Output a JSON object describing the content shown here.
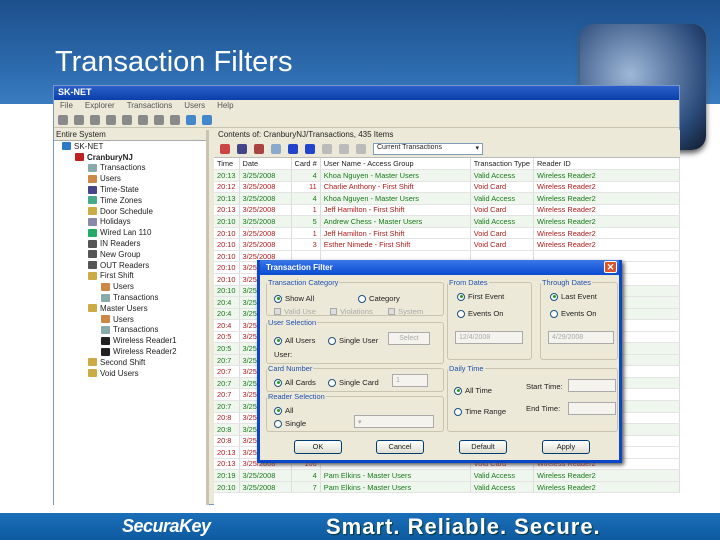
{
  "slide": {
    "title": "Transaction Filters",
    "logo": "SecuraKey",
    "tagline": "Smart. Reliable. Secure."
  },
  "app": {
    "title": "SK-NET",
    "menu": [
      "File",
      "Explorer",
      "Transactions",
      "Users",
      "Help"
    ]
  },
  "tree": {
    "header": "Entire System",
    "items": [
      {
        "label": "SK-NET",
        "lvl": 0,
        "c": "#2a7ac8"
      },
      {
        "label": "CranburyNJ",
        "lvl": 1,
        "c": "#c02020",
        "bold": true
      },
      {
        "label": "Transactions",
        "lvl": 2,
        "c": "#8aa"
      },
      {
        "label": "Users",
        "lvl": 2,
        "c": "#c84"
      },
      {
        "label": "Time-State",
        "lvl": 2,
        "c": "#448"
      },
      {
        "label": "Time Zones",
        "lvl": 2,
        "c": "#4a8"
      },
      {
        "label": "Door Schedule",
        "lvl": 2,
        "c": "#ca4"
      },
      {
        "label": "Holidays",
        "lvl": 2,
        "c": "#88a"
      },
      {
        "label": "Wired Lan 110",
        "lvl": 2,
        "c": "#2a6"
      },
      {
        "label": "IN Readers",
        "lvl": 2,
        "c": "#555"
      },
      {
        "label": "New Group",
        "lvl": 2,
        "c": "#555"
      },
      {
        "label": "OUT Readers",
        "lvl": 2,
        "c": "#555"
      },
      {
        "label": "First Shift",
        "lvl": 2,
        "c": "#ca4"
      },
      {
        "label": "Users",
        "lvl": 3,
        "c": "#c84"
      },
      {
        "label": "Transactions",
        "lvl": 3,
        "c": "#8aa"
      },
      {
        "label": "Master Users",
        "lvl": 2,
        "c": "#ca4"
      },
      {
        "label": "Users",
        "lvl": 3,
        "c": "#c84"
      },
      {
        "label": "Transactions",
        "lvl": 3,
        "c": "#8aa"
      },
      {
        "label": "Wireless Reader1",
        "lvl": 3,
        "c": "#222"
      },
      {
        "label": "Wireless Reader2",
        "lvl": 3,
        "c": "#222"
      },
      {
        "label": "Second Shift",
        "lvl": 2,
        "c": "#ca4"
      },
      {
        "label": "Void Users",
        "lvl": 2,
        "c": "#ca4"
      }
    ]
  },
  "grid": {
    "path": "Contents of: CranburyNJ/Transactions, 435 Items",
    "view": "Current Transactions",
    "columns": [
      "Time",
      "Date",
      "Card #",
      "User Name - Access Group",
      "Transaction Type",
      "Reader ID"
    ],
    "rows": [
      [
        "20:13",
        "3/25/2008",
        "4",
        "Khoa Nguyen - Master Users",
        "Valid Access",
        "Wireless Reader2",
        "g"
      ],
      [
        "20:12",
        "3/25/2008",
        "11",
        "Charlie Anthony - First Shift",
        "Void Card",
        "Wireless Reader2",
        "r"
      ],
      [
        "20:13",
        "3/25/2008",
        "4",
        "Khoa Nguyen - Master Users",
        "Valid Access",
        "Wireless Reader2",
        "g"
      ],
      [
        "20:13",
        "3/25/2008",
        "1",
        "Jeff Hamilton - First Shift",
        "Void Card",
        "Wireless Reader2",
        "r"
      ],
      [
        "20:10",
        "3/25/2008",
        "5",
        "Andrew Chess - Master Users",
        "Valid Access",
        "Wireless Reader2",
        "g"
      ],
      [
        "20:10",
        "3/25/2008",
        "1",
        "Jeff Hamilton - First Shift",
        "Void Card",
        "Wireless Reader2",
        "r"
      ],
      [
        "20:10",
        "3/25/2008",
        "3",
        "Esther Nimede - First Shift",
        "Void Card",
        "Wireless Reader2",
        "r"
      ],
      [
        "20:10",
        "3/25/2008",
        "",
        "",
        "",
        "",
        "r"
      ],
      [
        "20:10",
        "3/25/2008",
        "",
        "",
        "",
        "",
        "r"
      ],
      [
        "20:10",
        "3/25/2008",
        "",
        "",
        "",
        "",
        "r"
      ],
      [
        "20:10",
        "3/25/2008",
        "",
        "",
        "",
        "",
        "g"
      ],
      [
        "20:4",
        "3/25/2008",
        "",
        "",
        "",
        "",
        "g"
      ],
      [
        "20:4",
        "3/25/2008",
        "",
        "",
        "",
        "",
        "g"
      ],
      [
        "20:4",
        "3/25/2008",
        "",
        "",
        "",
        "",
        "r"
      ],
      [
        "20:5",
        "3/25/2008",
        "",
        "",
        "",
        "",
        "r"
      ],
      [
        "20:5",
        "3/25/2008",
        "",
        "",
        "",
        "",
        "g"
      ],
      [
        "20:7",
        "3/25/2008",
        "",
        "",
        "",
        "",
        "g"
      ],
      [
        "20:7",
        "3/25/2008",
        "",
        "",
        "",
        "",
        "r"
      ],
      [
        "20:7",
        "3/25/2008",
        "",
        "",
        "",
        "",
        "g"
      ],
      [
        "20:7",
        "3/25/2008",
        "",
        "",
        "",
        "",
        "r"
      ],
      [
        "20:7",
        "3/25/2008",
        "",
        "",
        "",
        "",
        "g"
      ],
      [
        "20:8",
        "3/25/2008",
        "",
        "",
        "",
        "",
        "r"
      ],
      [
        "20:8",
        "3/25/2008",
        "",
        "",
        "",
        "",
        "g"
      ],
      [
        "20:8",
        "3/25/2008",
        "",
        "",
        "",
        "",
        "r"
      ],
      [
        "20:13",
        "3/25/2008",
        "",
        "",
        "",
        "",
        "r"
      ],
      [
        "20:13",
        "3/25/2008",
        "106",
        "",
        "Void Card",
        "Wireless Reader2",
        "r"
      ],
      [
        "20:19",
        "3/25/2008",
        "4",
        "Pam Elkins - Master Users",
        "Valid Access",
        "Wireless Reader2",
        "g"
      ],
      [
        "20:10",
        "3/25/2008",
        "7",
        "Pam Elkins - Master Users",
        "Valid Access",
        "Wireless Reader2",
        "g"
      ]
    ]
  },
  "dialog": {
    "title": "Transaction Filter",
    "category": {
      "legend": "Transaction Category",
      "show_all": "Show All",
      "category": "Category",
      "valid_use": "Valid Use",
      "violations": "Violations",
      "system": "System"
    },
    "user": {
      "legend": "User Selection",
      "all_users": "All Users",
      "single_user": "Single User",
      "select": "Select",
      "user_label": "User:"
    },
    "card": {
      "legend": "Card Number",
      "all_cards": "All Cards",
      "single_card": "Single Card",
      "value": "1"
    },
    "reader": {
      "legend": "Reader Selection",
      "all": "All",
      "single": "Single"
    },
    "from": {
      "legend": "From Dates",
      "first_event": "First Event",
      "events_on": "Events On",
      "date": "12/4/2008"
    },
    "through": {
      "legend": "Through Dates",
      "last_event": "Last Event",
      "events_on": "Events On",
      "date": "4/29/2008"
    },
    "time": {
      "legend": "Daily Time",
      "all_time": "All Time",
      "time_range": "Time Range",
      "start": "Start Time:",
      "end": "End Time:"
    },
    "buttons": {
      "ok": "OK",
      "cancel": "Cancel",
      "default": "Default",
      "apply": "Apply"
    }
  }
}
